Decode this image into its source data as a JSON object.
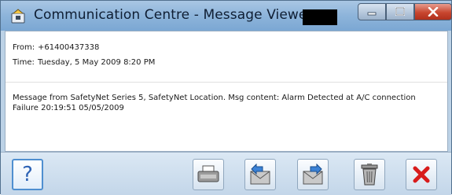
{
  "window": {
    "title": "Communication Centre - Message Viewer...",
    "controls": [
      "minimize-icon",
      "maximize-icon",
      "close-icon"
    ]
  },
  "header": {
    "from_label": "From:",
    "from_value": "+61400437338",
    "time_label": "Time:",
    "time_value": "Tuesday, 5 May 2009 8:20 PM"
  },
  "message": {
    "body": "Message from SafetyNet Series 5, SafetyNet Location. Msg content: Alarm Detected at A/C connection Failure 20:19:51 05/05/2009"
  },
  "toolbar": {
    "help_label": "?",
    "buttons": [
      "help-icon",
      "print-icon",
      "reply-icon",
      "forward-icon",
      "delete-icon",
      "close-icon"
    ]
  },
  "colors": {
    "titlebar": "#8db4da",
    "help_accent": "#2e63b5",
    "close_red": "#d81c1c"
  }
}
